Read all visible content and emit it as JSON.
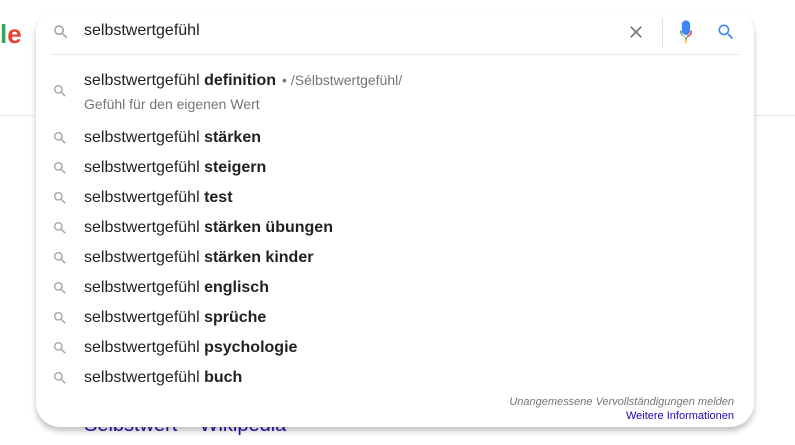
{
  "logo_fragment": {
    "l": "l",
    "e": "e"
  },
  "background_result": {
    "title": "Selbstwert – Wikipedia"
  },
  "search": {
    "query": "selbstwertgefühl"
  },
  "suggestions": [
    {
      "prefix": "selbstwertgefühl ",
      "bold": "definition",
      "meta": "• /Sélbstwertgefühl/",
      "subtitle": "Gefühl für den eigenen Wert"
    },
    {
      "prefix": "selbstwertgefühl ",
      "bold": "stärken"
    },
    {
      "prefix": "selbstwertgefühl ",
      "bold": "steigern"
    },
    {
      "prefix": "selbstwertgefühl ",
      "bold": "test"
    },
    {
      "prefix": "selbstwertgefühl ",
      "bold": "stärken übungen"
    },
    {
      "prefix": "selbstwertgefühl ",
      "bold": "stärken kinder"
    },
    {
      "prefix": "selbstwertgefühl ",
      "bold": "englisch"
    },
    {
      "prefix": "selbstwertgefühl ",
      "bold": "sprüche"
    },
    {
      "prefix": "selbstwertgefühl ",
      "bold": "psychologie"
    },
    {
      "prefix": "selbstwertgefühl ",
      "bold": "buch"
    }
  ],
  "footer": {
    "report": "Unangemessene Vervollständigungen melden",
    "more_info": "Weitere Informationen"
  },
  "icons": {
    "search": "search-icon",
    "clear": "close-icon",
    "mic": "microphone-icon",
    "search_submit": "search-icon"
  },
  "colors": {
    "google_blue": "#4285f4",
    "google_red": "#ea4335",
    "google_green": "#34a853",
    "google_yellow": "#fbbc05",
    "link": "#1a0dab",
    "muted": "#70757a"
  }
}
